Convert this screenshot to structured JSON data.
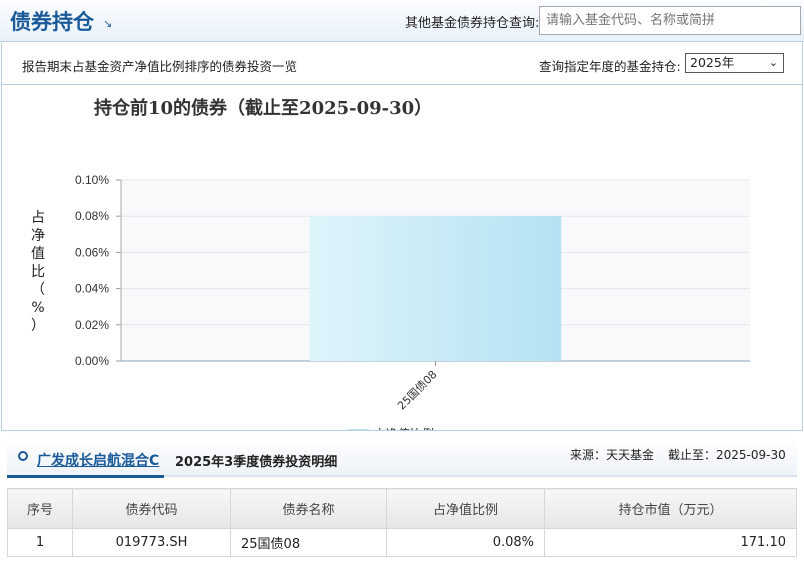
{
  "header": {
    "title": "债券持仓",
    "title_arrow": "↘",
    "search_label": "其他基金债券持仓查询:",
    "search_placeholder": "请输入基金代码、名称或简拼"
  },
  "subbar": {
    "description": "报告期末占基金资产净值比例排序的债券投资一览",
    "year_label": "查询指定年度的基金持仓:",
    "year_selected": "2025年"
  },
  "chart_data": {
    "type": "bar",
    "title": "持仓前10的债券（截止至2025-09-30）",
    "ylabel": "占净值比（%）",
    "xlabel": "",
    "categories": [
      "25国债08"
    ],
    "series": [
      {
        "name": "占净值比例",
        "values": [
          0.08
        ]
      }
    ],
    "ylim": [
      0,
      0.1
    ],
    "yticks": [
      "0.00%",
      "0.02%",
      "0.04%",
      "0.06%",
      "0.08%",
      "0.10%"
    ],
    "grid": true,
    "legend_position": "bottom-center",
    "colors": {
      "bar_left": "#dff4fb",
      "bar_right": "#b3e2f2",
      "legend": "#bfe6f5"
    }
  },
  "detail": {
    "fund_name": "广发成长启航混合C",
    "title": "2025年3季度债券投资明细",
    "source": "来源：天天基金",
    "as_of": "截止至：2025-09-30",
    "columns": [
      "序号",
      "债券代码",
      "债券名称",
      "占净值比例",
      "持仓市值（万元）"
    ],
    "rows": [
      {
        "index": "1",
        "code": "019773.SH",
        "name": "25国债08",
        "ratio": "0.08%",
        "value": "171.10"
      }
    ]
  },
  "colors": {
    "brand": "#1a5a99"
  }
}
